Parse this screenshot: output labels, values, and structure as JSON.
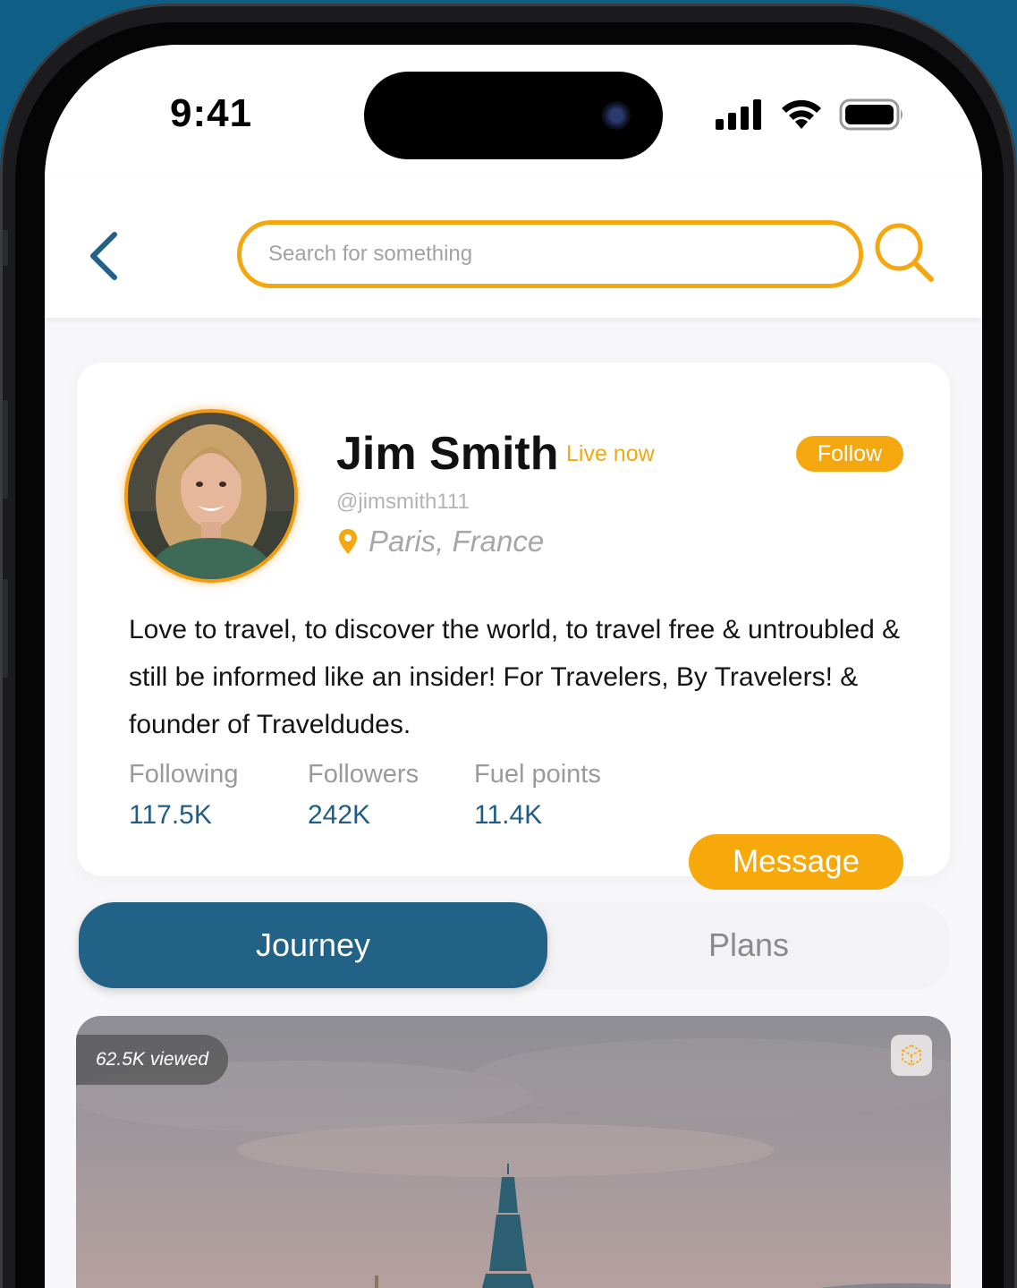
{
  "status_bar": {
    "time": "9:41"
  },
  "header": {
    "search_placeholder": "Search for something"
  },
  "profile": {
    "name": "Jim Smith",
    "live_label": "Live now",
    "follow_label": "Follow",
    "handle": "@jimsmith111",
    "location": "Paris, France",
    "bio": "Love to travel, to discover the world, to travel free & untroubled & still be informed like an insider! For Travelers, By Travelers! & founder of Traveldudes.",
    "stats": [
      {
        "label": "Following",
        "value": "117.5K"
      },
      {
        "label": "Followers",
        "value": "242K"
      },
      {
        "label": "Fuel points",
        "value": "11.4K"
      }
    ],
    "message_label": "Message"
  },
  "tabs": [
    {
      "label": "Journey",
      "active": true
    },
    {
      "label": "Plans",
      "active": false
    }
  ],
  "post": {
    "views": "62.5K viewed"
  },
  "colors": {
    "accent_orange": "#f5a70f",
    "primary_blue": "#236287",
    "stat_value_blue": "#1f5d86",
    "page_background": "#0f5e86"
  },
  "icons": {
    "back": "chevron-left-icon",
    "search": "search-icon",
    "location": "map-pin-icon",
    "ar": "ar-cube-icon",
    "signal": "cellular-signal-icon",
    "wifi": "wifi-icon",
    "battery": "battery-icon"
  }
}
